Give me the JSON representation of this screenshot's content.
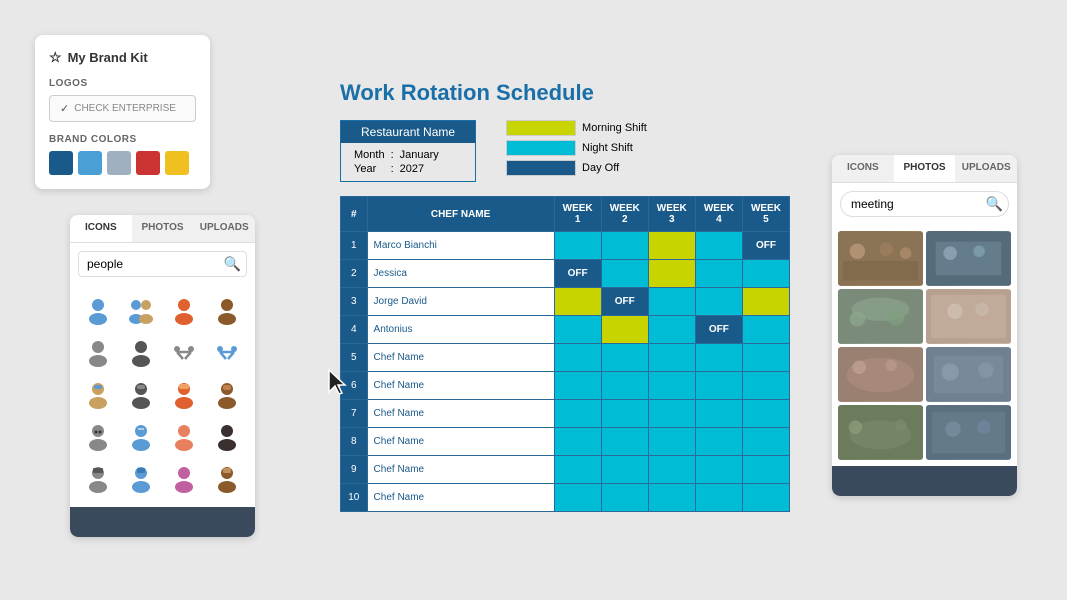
{
  "brand_kit": {
    "title": "My Brand Kit",
    "logos_label": "LOGOS",
    "check_enterprise_label": "CHECK ENTERPRISE",
    "brand_colors_label": "BRAND COLORS",
    "colors": [
      "#1a5a8a",
      "#4a9fd4",
      "#a0b0c0",
      "#cc3333",
      "#f0c020"
    ]
  },
  "icons_panel": {
    "tabs": [
      "ICONS",
      "PHOTOS",
      "UPLOADS"
    ],
    "active_tab": "ICONS",
    "search_value": "people",
    "search_placeholder": "people"
  },
  "schedule": {
    "title": "Work Rotation Schedule",
    "restaurant_label": "Restaurant Name",
    "month_label": "Month",
    "month_value": "January",
    "year_label": "Year",
    "year_value": "2027",
    "legend": [
      {
        "label": "Morning Shift",
        "color": "#c8d400"
      },
      {
        "label": "Night Shift",
        "color": "#00bcd4"
      },
      {
        "label": "Day Off",
        "color": "#1a5a8a"
      }
    ],
    "headers": [
      "#",
      "CHEF NAME",
      "WEEK 1",
      "WEEK 2",
      "WEEK 3",
      "WEEK 4",
      "WEEK 5"
    ],
    "rows": [
      {
        "num": "1",
        "name": "Marco Bianchi",
        "weeks": [
          "night",
          "night",
          "morning",
          "night",
          "off"
        ]
      },
      {
        "num": "2",
        "name": "Jessica",
        "weeks": [
          "off",
          "night",
          "morning",
          "night",
          "night"
        ]
      },
      {
        "num": "3",
        "name": "Jorge David",
        "weeks": [
          "morning",
          "off",
          "night",
          "night",
          "morning"
        ]
      },
      {
        "num": "4",
        "name": "Antonius",
        "weeks": [
          "night",
          "morning",
          "night",
          "off",
          "night"
        ]
      },
      {
        "num": "5",
        "name": "Chef Name",
        "weeks": [
          "night",
          "night",
          "night",
          "night",
          "night"
        ]
      },
      {
        "num": "6",
        "name": "Chef Name",
        "weeks": [
          "night",
          "night",
          "night",
          "night",
          "night"
        ]
      },
      {
        "num": "7",
        "name": "Chef Name",
        "weeks": [
          "night",
          "night",
          "night",
          "night",
          "night"
        ]
      },
      {
        "num": "8",
        "name": "Chef Name",
        "weeks": [
          "night",
          "night",
          "night",
          "night",
          "night"
        ]
      },
      {
        "num": "9",
        "name": "Chef Name",
        "weeks": [
          "night",
          "night",
          "night",
          "night",
          "night"
        ]
      },
      {
        "num": "10",
        "name": "Chef Name",
        "weeks": [
          "night",
          "night",
          "night",
          "night",
          "night"
        ]
      }
    ]
  },
  "photos_panel": {
    "tabs": [
      "ICONS",
      "PHOTOS",
      "UPLOADS"
    ],
    "active_tab": "PHOTOS",
    "search_value": "meeting",
    "search_placeholder": "meeting",
    "photos_count": 8
  }
}
